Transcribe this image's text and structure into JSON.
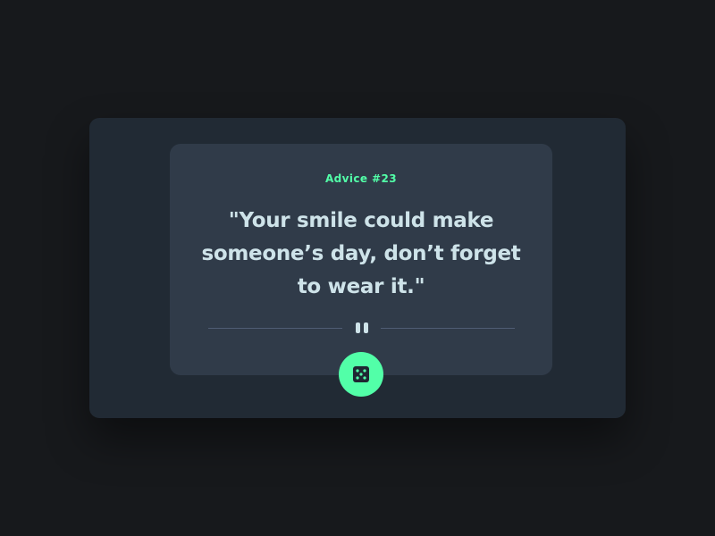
{
  "card": {
    "label": "Advice #23",
    "quote": "\"Your smile could make someone’s day, don’t forget to wear it.\""
  },
  "divider": {
    "icon": "pause-icon"
  },
  "action": {
    "icon": "dice-icon"
  },
  "colors": {
    "background": "#17191c",
    "panel": "#212a34",
    "card": "#303b49",
    "accent": "#52ffa8",
    "text": "#cee3e9",
    "divider": "#4f5d74"
  }
}
